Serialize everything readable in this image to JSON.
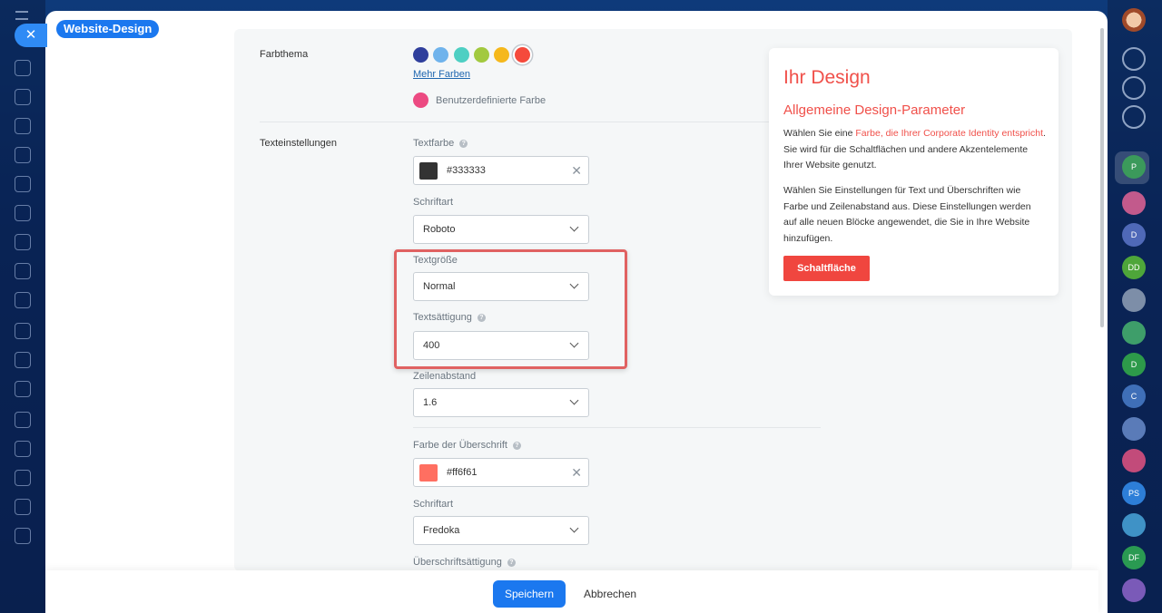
{
  "header": {
    "title": "Website-Design",
    "close_icon": "close-icon"
  },
  "left_sidebar": {
    "icons": [
      "menu-icon",
      "home-icon",
      "settings-icon",
      "hexagon-icon",
      "document-icon",
      "chat-icon",
      "calendar-icon",
      "drive-icon",
      "monitor-icon",
      "checklist-icon",
      "mail-icon",
      "gear-icon",
      "pen-icon",
      "cart-icon",
      "calendar-grid-icon",
      "card-icon",
      "filter-icon",
      "list-icon"
    ]
  },
  "right_sidebar": {
    "items": [
      {
        "initials": "",
        "color": "#ffffff"
      },
      {
        "initials": "",
        "color": "#3a6fc4"
      },
      {
        "initials": "",
        "color": "#3a6fc4"
      },
      {
        "initials": "",
        "color": "#3a6fc4"
      },
      {
        "initials": "P",
        "color": "#3b9a5b"
      },
      {
        "initials": "",
        "color": "#c25a8c"
      },
      {
        "initials": "D",
        "color": "#4f69b8"
      },
      {
        "initials": "DD",
        "color": "#4ea63a"
      },
      {
        "initials": "",
        "color": "#7d8ea8"
      },
      {
        "initials": "",
        "color": "#3e9e6a"
      },
      {
        "initials": "D",
        "color": "#2d9a4a"
      },
      {
        "initials": "C",
        "color": "#3f6fb8"
      },
      {
        "initials": "",
        "color": "#5a7bb8"
      },
      {
        "initials": "",
        "color": "#c24b7a"
      },
      {
        "initials": "PS",
        "color": "#2d7ed8"
      },
      {
        "initials": "",
        "color": "#3f92c6"
      },
      {
        "initials": "DF",
        "color": "#2a9a52"
      },
      {
        "initials": "",
        "color": "#7a5ab8"
      }
    ]
  },
  "color_theme": {
    "label": "Farbthema",
    "colors": [
      "#2f3f9c",
      "#6fb3ec",
      "#4ecfc3",
      "#a2c93f",
      "#f5b81c",
      "#f54a3c"
    ],
    "more_link": "Mehr Farben",
    "custom_label": "Benutzerdefinierte Farbe",
    "custom_color": "#ec4a82"
  },
  "text_settings": {
    "label": "Texteinstellungen",
    "text_color_label": "Textfarbe",
    "text_color_value": "#333333",
    "font_label": "Schriftart",
    "font_value": "Roboto",
    "size_label": "Textgröße",
    "size_value": "Normal",
    "weight_label": "Textsättigung",
    "weight_value": "400",
    "line_height_label": "Zeilenabstand",
    "line_height_value": "1.6",
    "heading_color_label": "Farbe der Überschrift",
    "heading_color_value": "#ff6f61",
    "heading_font_label": "Schriftart",
    "heading_font_value": "Fredoka",
    "heading_weight_label": "Überschriftsättigung"
  },
  "design_card": {
    "title": "Ihr Design",
    "subtitle": "Allgemeine Design-Parameter",
    "p1_before": "Wählen Sie eine ",
    "p1_accent": "Farbe, die Ihrer Corporate Identity entspricht",
    "p1_after": ". Sie wird für die Schaltflächen und andere Akzentelemente Ihrer Website genutzt.",
    "p2": "Wählen Sie Einstellungen für Text und Überschriften wie Farbe und Zeilenabstand aus. Diese Einstellungen werden auf alle neuen Blöcke angewendet, die Sie in Ihre Website hinzufügen.",
    "button": "Schaltfläche"
  },
  "footer": {
    "save": "Speichern",
    "cancel": "Abbrechen"
  }
}
